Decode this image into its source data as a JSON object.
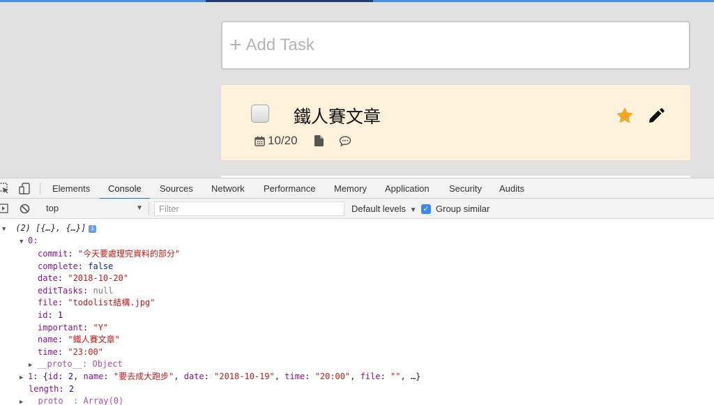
{
  "app": {
    "add_task_label": "Add Task",
    "add_task_icon": "plus-icon",
    "task": {
      "title": "鐵人賽文章",
      "date": "10/20",
      "important": true,
      "accent_color": "#f5a623",
      "card_color": "#fff2dc"
    }
  },
  "devtools": {
    "tabs": [
      "Elements",
      "Console",
      "Sources",
      "Network",
      "Performance",
      "Memory",
      "Application",
      "Security",
      "Audits"
    ],
    "active_tab": "Console",
    "context": "top",
    "filter_placeholder": "Filter",
    "levels": "Default levels",
    "group_similar": "Group similar",
    "group_similar_checked": true,
    "accent_color": "#1a73e8"
  },
  "console": {
    "array_summary": "(2) [{…}, {…}]",
    "item0_index": "0:",
    "fields": [
      {
        "key": "commit",
        "value": "\"今天要處理完資料的部分\"",
        "kind": "string"
      },
      {
        "key": "complete",
        "value": "false",
        "kind": "bool"
      },
      {
        "key": "date",
        "value": "\"2018-10-20\"",
        "kind": "string"
      },
      {
        "key": "editTasks",
        "value": "null",
        "kind": "null"
      },
      {
        "key": "file",
        "value": "\"todolist結構.jpg\"",
        "kind": "string"
      },
      {
        "key": "id",
        "value": "1",
        "kind": "number"
      },
      {
        "key": "important",
        "value": "\"Y\"",
        "kind": "string"
      },
      {
        "key": "name",
        "value": "\"鐵人賽文章\"",
        "kind": "string"
      },
      {
        "key": "time",
        "value": "\"23:00\"",
        "kind": "string"
      }
    ],
    "proto0": "__proto__: Object",
    "item1": {
      "index": "1",
      "id": "2",
      "name": "\"要去成大跑步\"",
      "date": "\"2018-10-19\"",
      "time": "\"20:00\"",
      "file": "\"\"",
      "rest": "…}"
    },
    "length_key": "length",
    "length_value": "2",
    "proto_array": "__proto__: Array(0)"
  }
}
